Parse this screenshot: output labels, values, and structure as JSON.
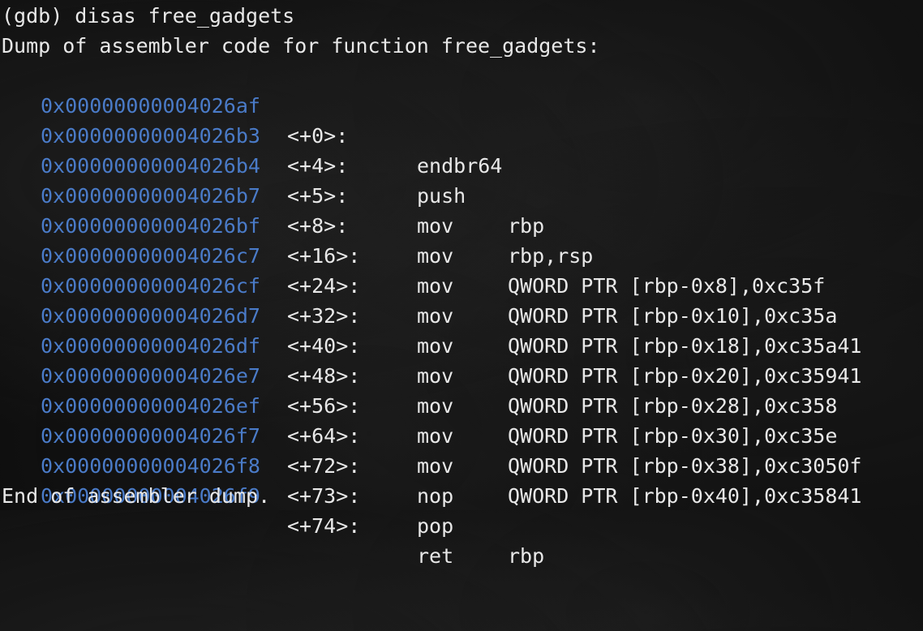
{
  "terminal": {
    "command_line": "(gdb) disas free_gadgets",
    "header": "Dump of assembler code for function free_gadgets:",
    "footer": "End of assembler dump.",
    "colors": {
      "background": "#0e0e0e",
      "text": "#e8e8e8",
      "address": "#4a7bc8"
    }
  },
  "instructions": [
    {
      "address": "0x00000000004026af",
      "offset": "<+0>:",
      "mnemonic": "endbr64",
      "operands": ""
    },
    {
      "address": "0x00000000004026b3",
      "offset": "<+4>:",
      "mnemonic": "push",
      "operands": "rbp"
    },
    {
      "address": "0x00000000004026b4",
      "offset": "<+5>:",
      "mnemonic": "mov",
      "operands": "rbp,rsp"
    },
    {
      "address": "0x00000000004026b7",
      "offset": "<+8>:",
      "mnemonic": "mov",
      "operands": "QWORD PTR [rbp-0x8],0xc35f"
    },
    {
      "address": "0x00000000004026bf",
      "offset": "<+16>:",
      "mnemonic": "mov",
      "operands": "QWORD PTR [rbp-0x10],0xc35a"
    },
    {
      "address": "0x00000000004026c7",
      "offset": "<+24>:",
      "mnemonic": "mov",
      "operands": "QWORD PTR [rbp-0x18],0xc35a41"
    },
    {
      "address": "0x00000000004026cf",
      "offset": "<+32>:",
      "mnemonic": "mov",
      "operands": "QWORD PTR [rbp-0x20],0xc35941"
    },
    {
      "address": "0x00000000004026d7",
      "offset": "<+40>:",
      "mnemonic": "mov",
      "operands": "QWORD PTR [rbp-0x28],0xc358"
    },
    {
      "address": "0x00000000004026df",
      "offset": "<+48>:",
      "mnemonic": "mov",
      "operands": "QWORD PTR [rbp-0x30],0xc35e"
    },
    {
      "address": "0x00000000004026e7",
      "offset": "<+56>:",
      "mnemonic": "mov",
      "operands": "QWORD PTR [rbp-0x38],0xc3050f"
    },
    {
      "address": "0x00000000004026ef",
      "offset": "<+64>:",
      "mnemonic": "mov",
      "operands": "QWORD PTR [rbp-0x40],0xc35841"
    },
    {
      "address": "0x00000000004026f7",
      "offset": "<+72>:",
      "mnemonic": "nop",
      "operands": ""
    },
    {
      "address": "0x00000000004026f8",
      "offset": "<+73>:",
      "mnemonic": "pop",
      "operands": "rbp"
    },
    {
      "address": "0x00000000004026f9",
      "offset": "<+74>:",
      "mnemonic": "ret",
      "operands": ""
    }
  ]
}
